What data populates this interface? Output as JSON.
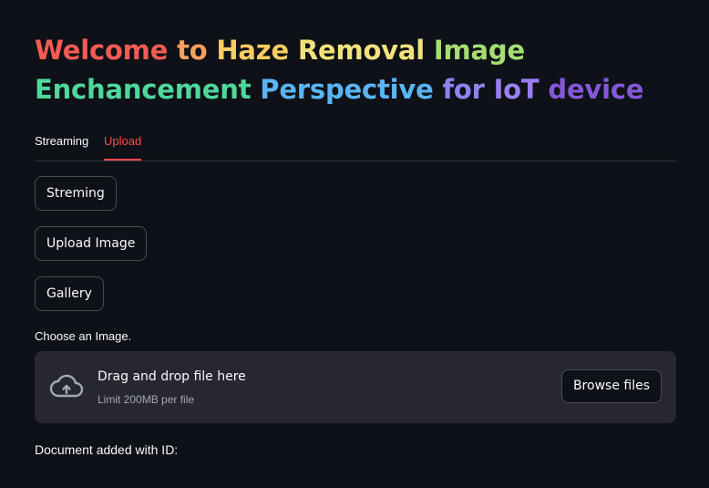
{
  "title": {
    "line1": [
      {
        "text": "Welcome ",
        "color": "#f35b54"
      },
      {
        "text": "to ",
        "color": "#f5a05c"
      },
      {
        "text": "Haze ",
        "color": "#f8cd61"
      },
      {
        "text": "Removal ",
        "color": "#f3e27c"
      },
      {
        "text": "Image",
        "color": "#a6dd73"
      }
    ],
    "line2": [
      {
        "text": "Enchancement ",
        "color": "#4fd79c"
      },
      {
        "text": "Perspective ",
        "color": "#5ab4f4"
      },
      {
        "text": "for ",
        "color": "#8e84f0"
      },
      {
        "text": "IoT ",
        "color": "#9b7ff1"
      },
      {
        "text": "device",
        "color": "#8458d8"
      }
    ]
  },
  "tabs": [
    {
      "label": "Streaming",
      "active": false
    },
    {
      "label": "Upload",
      "active": true
    }
  ],
  "buttons": {
    "streaming": "Streming",
    "upload_image": "Upload Image",
    "gallery": "Gallery"
  },
  "uploader": {
    "label": "Choose an Image.",
    "drop_text": "Drag and drop file here",
    "limit_text": "Limit 200MB per file",
    "browse_label": "Browse files",
    "icon": "cloud-upload-icon"
  },
  "status": {
    "document_text": "Document added with ID:"
  },
  "colors": {
    "background": "#0e1117",
    "accent": "#ff4b4b",
    "panel": "#262730"
  }
}
